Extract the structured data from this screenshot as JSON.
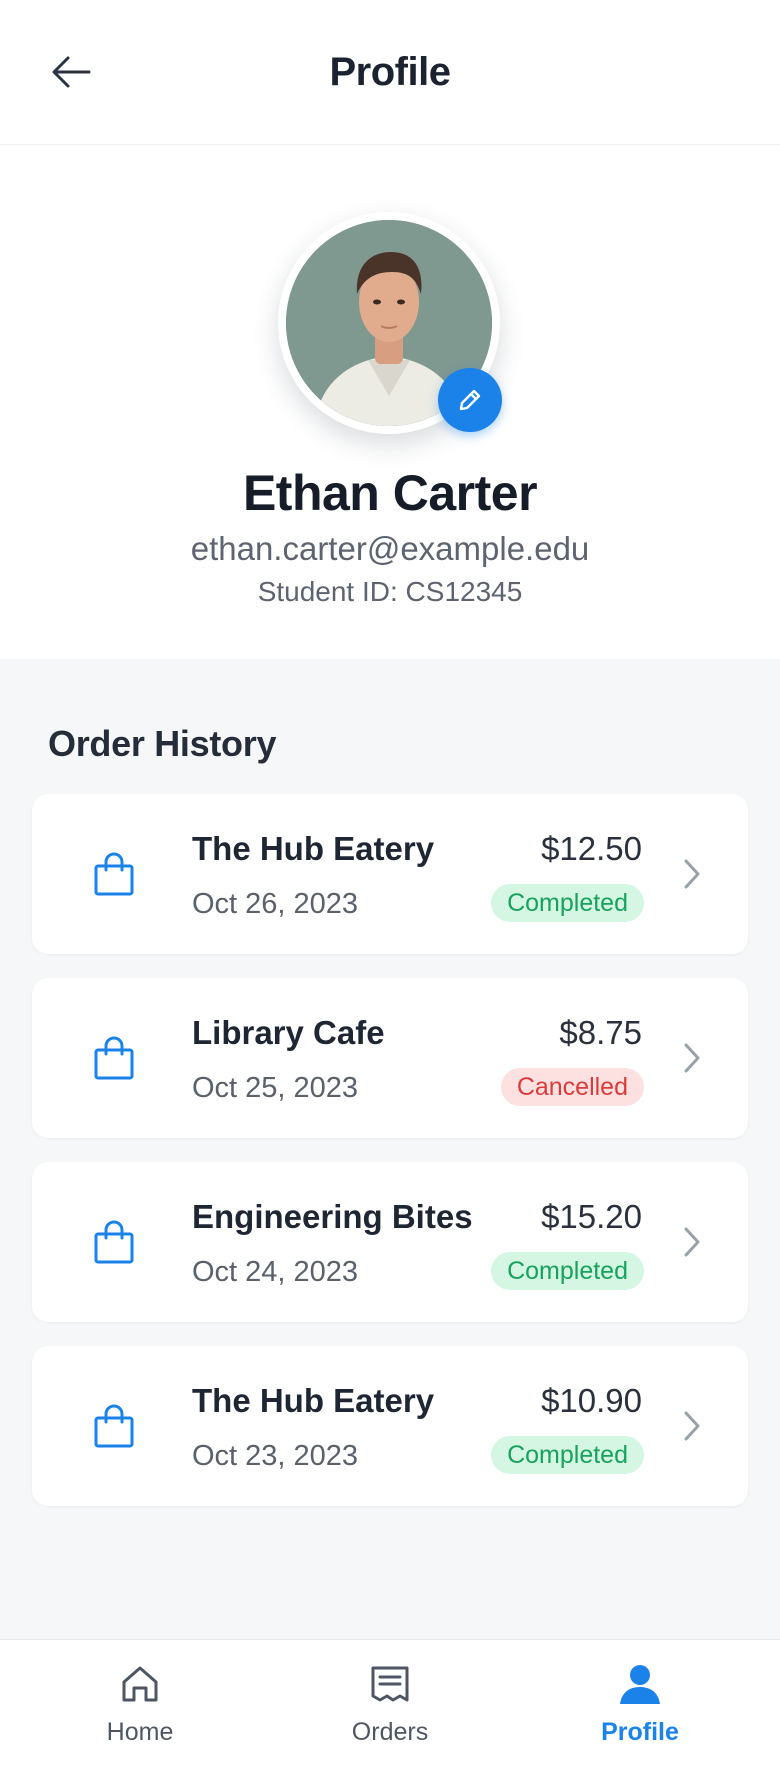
{
  "header": {
    "title": "Profile"
  },
  "profile": {
    "name": "Ethan Carter",
    "email": "ethan.carter@example.edu",
    "student_id": "Student ID: CS12345"
  },
  "order_history": {
    "title": "Order History",
    "orders": [
      {
        "name": "The Hub Eatery",
        "date": "Oct 26, 2023",
        "price": "$12.50",
        "status": "Completed"
      },
      {
        "name": "Library Cafe",
        "date": "Oct 25, 2023",
        "price": "$8.75",
        "status": "Cancelled"
      },
      {
        "name": "Engineering Bites",
        "date": "Oct 24, 2023",
        "price": "$15.20",
        "status": "Completed"
      },
      {
        "name": "The Hub Eatery",
        "date": "Oct 23, 2023",
        "price": "$10.90",
        "status": "Completed"
      }
    ]
  },
  "bottom_nav": {
    "items": [
      {
        "label": "Home",
        "icon": "home-icon",
        "active": false
      },
      {
        "label": "Orders",
        "icon": "receipt-icon",
        "active": false
      },
      {
        "label": "Profile",
        "icon": "user-icon",
        "active": true
      }
    ]
  },
  "colors": {
    "accent": "#1b82ea",
    "completed_bg": "#d6f6e4",
    "completed_text": "#16a35c",
    "cancelled_bg": "#fde0e0",
    "cancelled_text": "#dc3b3b"
  }
}
